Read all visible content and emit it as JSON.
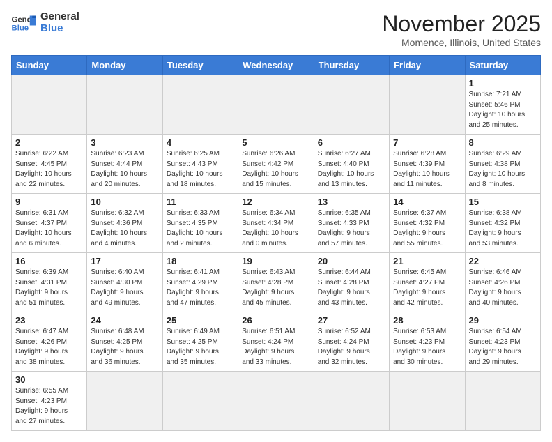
{
  "logo": {
    "line1": "General",
    "line2": "Blue"
  },
  "title": "November 2025",
  "subtitle": "Momence, Illinois, United States",
  "days_of_week": [
    "Sunday",
    "Monday",
    "Tuesday",
    "Wednesday",
    "Thursday",
    "Friday",
    "Saturday"
  ],
  "weeks": [
    [
      {
        "day": "",
        "info": "",
        "empty": true
      },
      {
        "day": "",
        "info": "",
        "empty": true
      },
      {
        "day": "",
        "info": "",
        "empty": true
      },
      {
        "day": "",
        "info": "",
        "empty": true
      },
      {
        "day": "",
        "info": "",
        "empty": true
      },
      {
        "day": "",
        "info": "",
        "empty": true
      },
      {
        "day": "1",
        "info": "Sunrise: 7:21 AM\nSunset: 5:46 PM\nDaylight: 10 hours\nand 25 minutes."
      }
    ],
    [
      {
        "day": "2",
        "info": "Sunrise: 6:22 AM\nSunset: 4:45 PM\nDaylight: 10 hours\nand 22 minutes."
      },
      {
        "day": "3",
        "info": "Sunrise: 6:23 AM\nSunset: 4:44 PM\nDaylight: 10 hours\nand 20 minutes."
      },
      {
        "day": "4",
        "info": "Sunrise: 6:25 AM\nSunset: 4:43 PM\nDaylight: 10 hours\nand 18 minutes."
      },
      {
        "day": "5",
        "info": "Sunrise: 6:26 AM\nSunset: 4:42 PM\nDaylight: 10 hours\nand 15 minutes."
      },
      {
        "day": "6",
        "info": "Sunrise: 6:27 AM\nSunset: 4:40 PM\nDaylight: 10 hours\nand 13 minutes."
      },
      {
        "day": "7",
        "info": "Sunrise: 6:28 AM\nSunset: 4:39 PM\nDaylight: 10 hours\nand 11 minutes."
      },
      {
        "day": "8",
        "info": "Sunrise: 6:29 AM\nSunset: 4:38 PM\nDaylight: 10 hours\nand 8 minutes."
      }
    ],
    [
      {
        "day": "9",
        "info": "Sunrise: 6:31 AM\nSunset: 4:37 PM\nDaylight: 10 hours\nand 6 minutes."
      },
      {
        "day": "10",
        "info": "Sunrise: 6:32 AM\nSunset: 4:36 PM\nDaylight: 10 hours\nand 4 minutes."
      },
      {
        "day": "11",
        "info": "Sunrise: 6:33 AM\nSunset: 4:35 PM\nDaylight: 10 hours\nand 2 minutes."
      },
      {
        "day": "12",
        "info": "Sunrise: 6:34 AM\nSunset: 4:34 PM\nDaylight: 10 hours\nand 0 minutes."
      },
      {
        "day": "13",
        "info": "Sunrise: 6:35 AM\nSunset: 4:33 PM\nDaylight: 9 hours\nand 57 minutes."
      },
      {
        "day": "14",
        "info": "Sunrise: 6:37 AM\nSunset: 4:32 PM\nDaylight: 9 hours\nand 55 minutes."
      },
      {
        "day": "15",
        "info": "Sunrise: 6:38 AM\nSunset: 4:32 PM\nDaylight: 9 hours\nand 53 minutes."
      }
    ],
    [
      {
        "day": "16",
        "info": "Sunrise: 6:39 AM\nSunset: 4:31 PM\nDaylight: 9 hours\nand 51 minutes."
      },
      {
        "day": "17",
        "info": "Sunrise: 6:40 AM\nSunset: 4:30 PM\nDaylight: 9 hours\nand 49 minutes."
      },
      {
        "day": "18",
        "info": "Sunrise: 6:41 AM\nSunset: 4:29 PM\nDaylight: 9 hours\nand 47 minutes."
      },
      {
        "day": "19",
        "info": "Sunrise: 6:43 AM\nSunset: 4:28 PM\nDaylight: 9 hours\nand 45 minutes."
      },
      {
        "day": "20",
        "info": "Sunrise: 6:44 AM\nSunset: 4:28 PM\nDaylight: 9 hours\nand 43 minutes."
      },
      {
        "day": "21",
        "info": "Sunrise: 6:45 AM\nSunset: 4:27 PM\nDaylight: 9 hours\nand 42 minutes."
      },
      {
        "day": "22",
        "info": "Sunrise: 6:46 AM\nSunset: 4:26 PM\nDaylight: 9 hours\nand 40 minutes."
      }
    ],
    [
      {
        "day": "23",
        "info": "Sunrise: 6:47 AM\nSunset: 4:26 PM\nDaylight: 9 hours\nand 38 minutes."
      },
      {
        "day": "24",
        "info": "Sunrise: 6:48 AM\nSunset: 4:25 PM\nDaylight: 9 hours\nand 36 minutes."
      },
      {
        "day": "25",
        "info": "Sunrise: 6:49 AM\nSunset: 4:25 PM\nDaylight: 9 hours\nand 35 minutes."
      },
      {
        "day": "26",
        "info": "Sunrise: 6:51 AM\nSunset: 4:24 PM\nDaylight: 9 hours\nand 33 minutes."
      },
      {
        "day": "27",
        "info": "Sunrise: 6:52 AM\nSunset: 4:24 PM\nDaylight: 9 hours\nand 32 minutes."
      },
      {
        "day": "28",
        "info": "Sunrise: 6:53 AM\nSunset: 4:23 PM\nDaylight: 9 hours\nand 30 minutes."
      },
      {
        "day": "29",
        "info": "Sunrise: 6:54 AM\nSunset: 4:23 PM\nDaylight: 9 hours\nand 29 minutes."
      }
    ],
    [
      {
        "day": "30",
        "info": "Sunrise: 6:55 AM\nSunset: 4:23 PM\nDaylight: 9 hours\nand 27 minutes."
      },
      {
        "day": "",
        "info": "",
        "empty": true
      },
      {
        "day": "",
        "info": "",
        "empty": true
      },
      {
        "day": "",
        "info": "",
        "empty": true
      },
      {
        "day": "",
        "info": "",
        "empty": true
      },
      {
        "day": "",
        "info": "",
        "empty": true
      },
      {
        "day": "",
        "info": "",
        "empty": true
      }
    ]
  ]
}
